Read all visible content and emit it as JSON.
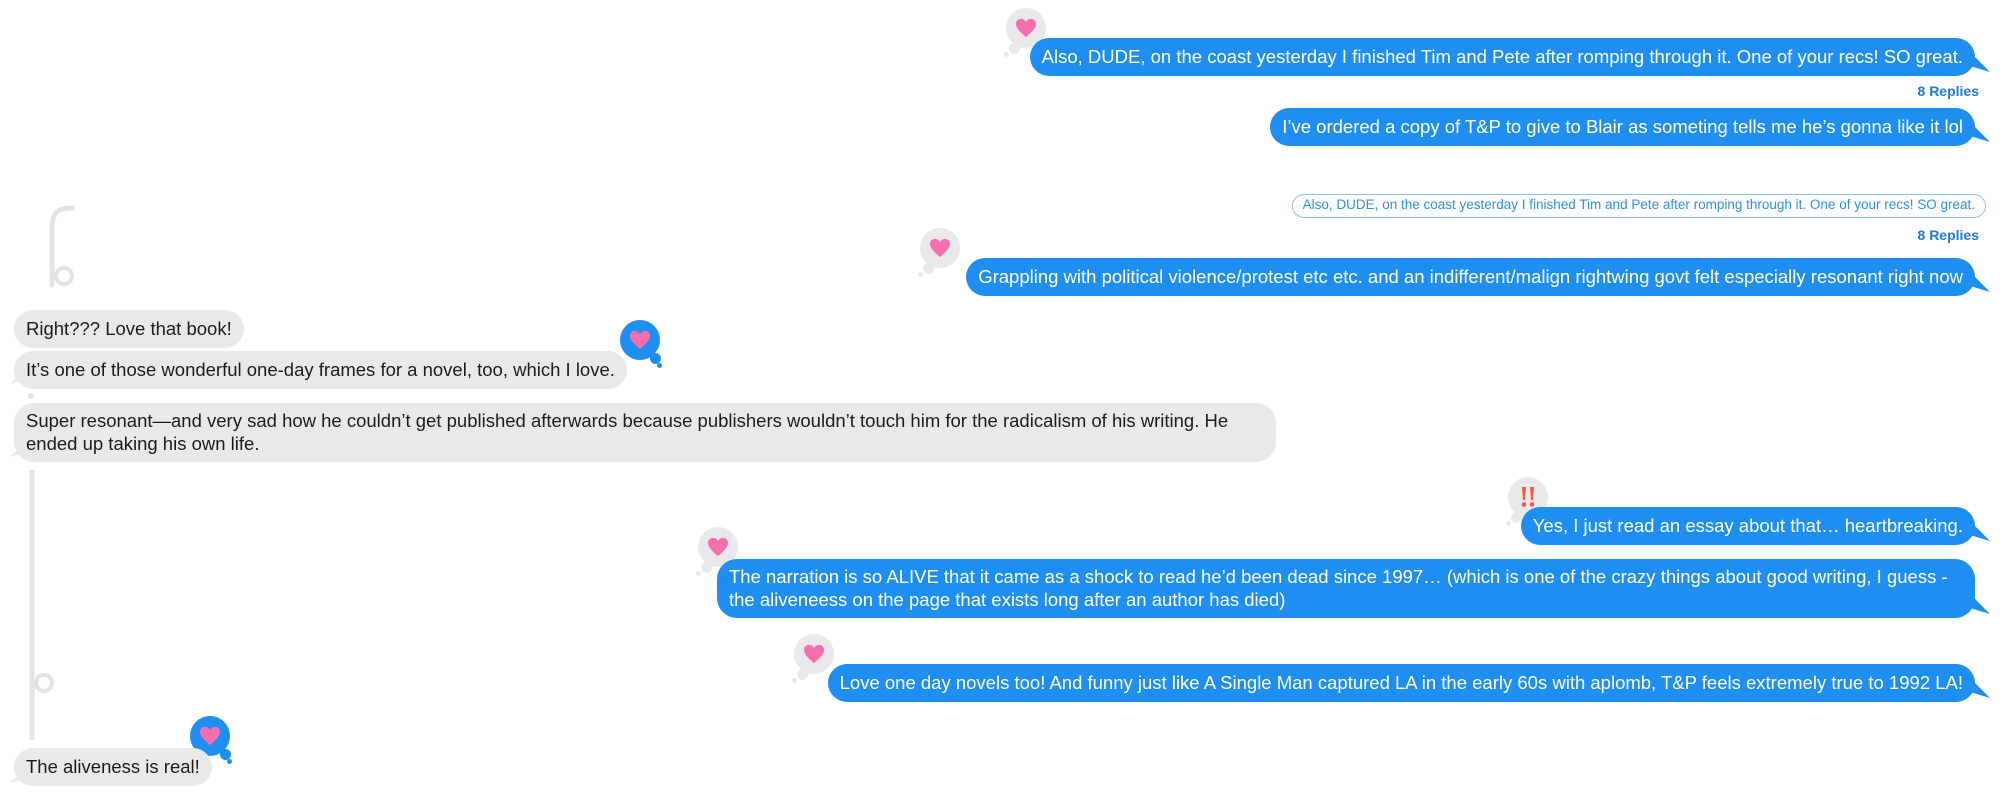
{
  "colors": {
    "outgoing_bubble": "#1f8ef1",
    "incoming_bubble": "#e9e9eb",
    "replies_link": "#1f7ae0",
    "thread_line": "#e3e3e5",
    "heart": "#f56fae",
    "exclamation": "#f25a4a"
  },
  "messages": [
    {
      "id": "m1",
      "sender": "me",
      "text": "Also, DUDE, on the coast yesterday I finished Tim and Pete after romping through it. One of your recs! SO great.",
      "tapback": "heart",
      "replies_label": "8 Replies"
    },
    {
      "id": "m2",
      "sender": "me",
      "text": "I’ve ordered a copy of T&P to give to Blair as someting tells me he’s gonna like it lol"
    },
    {
      "id": "q1",
      "type": "quoted_reply",
      "text": "Also, DUDE, on the coast yesterday I finished Tim and Pete after romping through it. One of your recs! SO great.",
      "replies_label": "8 Replies"
    },
    {
      "id": "m3",
      "sender": "me",
      "text": "Grappling with political violence/protest etc etc. and an indifferent/malign rightwing govt felt especially resonant right now",
      "tapback": "heart"
    },
    {
      "id": "m4",
      "sender": "them",
      "text": "Right??? Love that book!"
    },
    {
      "id": "m5",
      "sender": "them",
      "text": "It’s one of those wonderful one-day frames for a novel, too, which I love.",
      "tapback": "heart"
    },
    {
      "id": "m6",
      "sender": "them",
      "text": "Super resonant—and very sad how he couldn’t get published afterwards because publishers wouldn’t touch him for the radicalism of his writing. He ended up taking his own life."
    },
    {
      "id": "m7",
      "sender": "me",
      "text": "Yes, I just read an essay about that… heartbreaking.",
      "tapback": "exclamation"
    },
    {
      "id": "m8",
      "sender": "me",
      "text": "The narration is so ALIVE that it came as a shock to read he’d been dead since 1997… (which is one of the crazy things about good writing, I guess - the aliveneess on the page that exists long after an author has died)",
      "tapback": "heart"
    },
    {
      "id": "m9",
      "sender": "me",
      "text": "Love one day novels too! And funny just like A Single Man captured LA in the early 60s with aplomb, T&P feels extremely true to 1992 LA!",
      "tapback": "heart"
    },
    {
      "id": "m10",
      "sender": "them",
      "text": "The aliveness is real!",
      "tapback": "heart"
    }
  ]
}
